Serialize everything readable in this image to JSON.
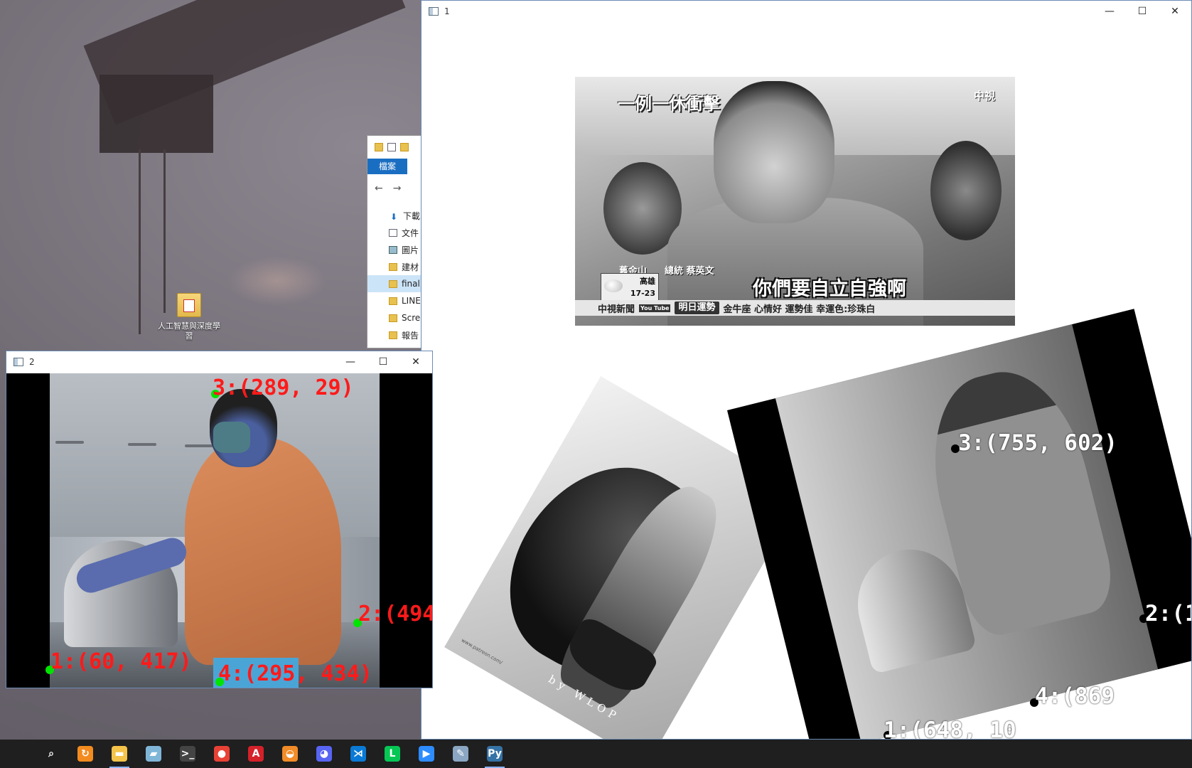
{
  "desktop": {
    "icon_label": "人工智慧與深度學習"
  },
  "explorer": {
    "ribbon_tab": "檔案",
    "nav_items": [
      {
        "label": "下載",
        "icon": "download-icon"
      },
      {
        "label": "文件",
        "icon": "document-icon"
      },
      {
        "label": "圖片",
        "icon": "picture-icon"
      },
      {
        "label": "建材",
        "icon": "folder-icon"
      },
      {
        "label": "final",
        "icon": "folder-icon",
        "selected": true
      },
      {
        "label": "LINE",
        "icon": "folder-icon"
      },
      {
        "label": "Screenshots",
        "icon": "folder-icon"
      },
      {
        "label": "報告",
        "icon": "folder-icon"
      }
    ]
  },
  "window1": {
    "title": "1",
    "news": {
      "headline": "一例一休衝擊",
      "logo": "中視",
      "location": "舊金山",
      "speaker": "總統 蔡英文",
      "weather_city": "高雄",
      "weather_temp": "17-23",
      "caption": "你們要自立自強啊",
      "ticker_source": "中視新聞",
      "ticker_youtube": "You Tube",
      "ticker_title": "明日運勢",
      "ticker_text": "金牛座 心情好 運勢佳 幸運色:珍珠白"
    },
    "art": {
      "signature": "by WLOP",
      "url": "www.patreon.com/"
    },
    "points": [
      {
        "label": "3:(755, 602)"
      },
      {
        "label": "2:(1"
      },
      {
        "label": "4:(869"
      },
      {
        "label": "1:(648, 10"
      }
    ]
  },
  "window2": {
    "title": "2",
    "points": [
      {
        "label": "3:(289, 29)"
      },
      {
        "label": "2:(494"
      },
      {
        "label": "1:(60, 417)"
      },
      {
        "label": "4:(295, 434)"
      }
    ]
  },
  "window_controls": {
    "minimize": "—",
    "maximize": "☐",
    "close": "✕"
  },
  "taskbar": {
    "items": [
      {
        "name": "start-button",
        "glyph": ""
      },
      {
        "name": "search-button",
        "glyph": "⌕"
      },
      {
        "name": "app-sync",
        "glyph": "↻"
      },
      {
        "name": "file-explorer",
        "glyph": "▬"
      },
      {
        "name": "app-notes",
        "glyph": "▰"
      },
      {
        "name": "terminal",
        "glyph": ">_"
      },
      {
        "name": "chrome",
        "glyph": "●"
      },
      {
        "name": "acrobat",
        "glyph": "A"
      },
      {
        "name": "app-burger",
        "glyph": "◒"
      },
      {
        "name": "discord",
        "glyph": "◕"
      },
      {
        "name": "vscode",
        "glyph": "⋊"
      },
      {
        "name": "line",
        "glyph": "L"
      },
      {
        "name": "zoom",
        "glyph": "▶"
      },
      {
        "name": "paint",
        "glyph": "✎"
      },
      {
        "name": "python",
        "glyph": "Py"
      }
    ],
    "colors": {
      "chrome": "#e84135",
      "acrobat": "#d4212a",
      "discord": "#5865f2",
      "vscode": "#0a7ad6",
      "line": "#06c755",
      "zoom": "#2d8cff",
      "python": "#3572a5",
      "file-explorer": "#f4c34a",
      "app-burger": "#f28c28",
      "app-sync": "#f38b1f",
      "app-notes": "#7fb6d8",
      "terminal": "#444",
      "paint": "#8aa6c2"
    }
  }
}
